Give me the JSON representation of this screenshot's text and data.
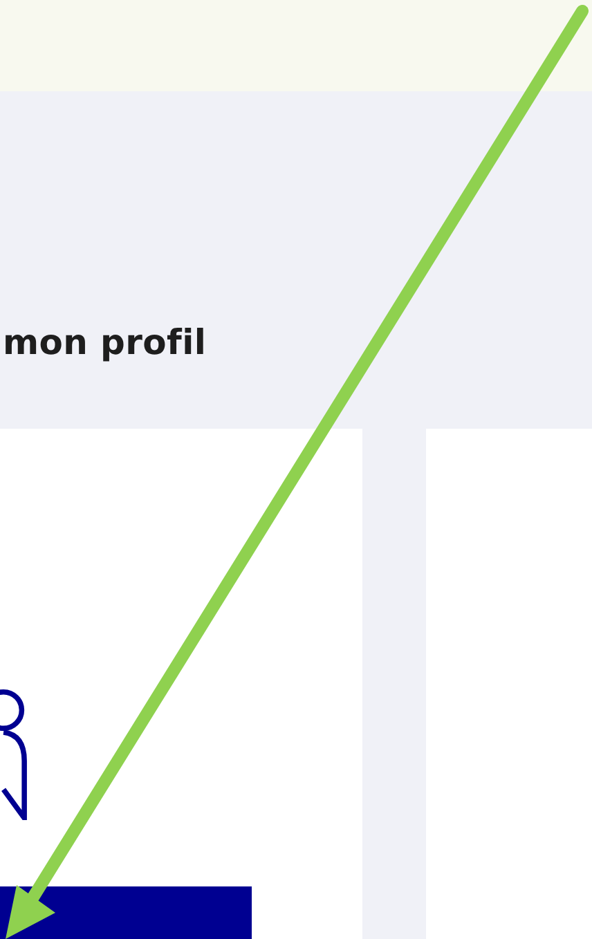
{
  "page": {
    "heading": "mon profil"
  }
}
